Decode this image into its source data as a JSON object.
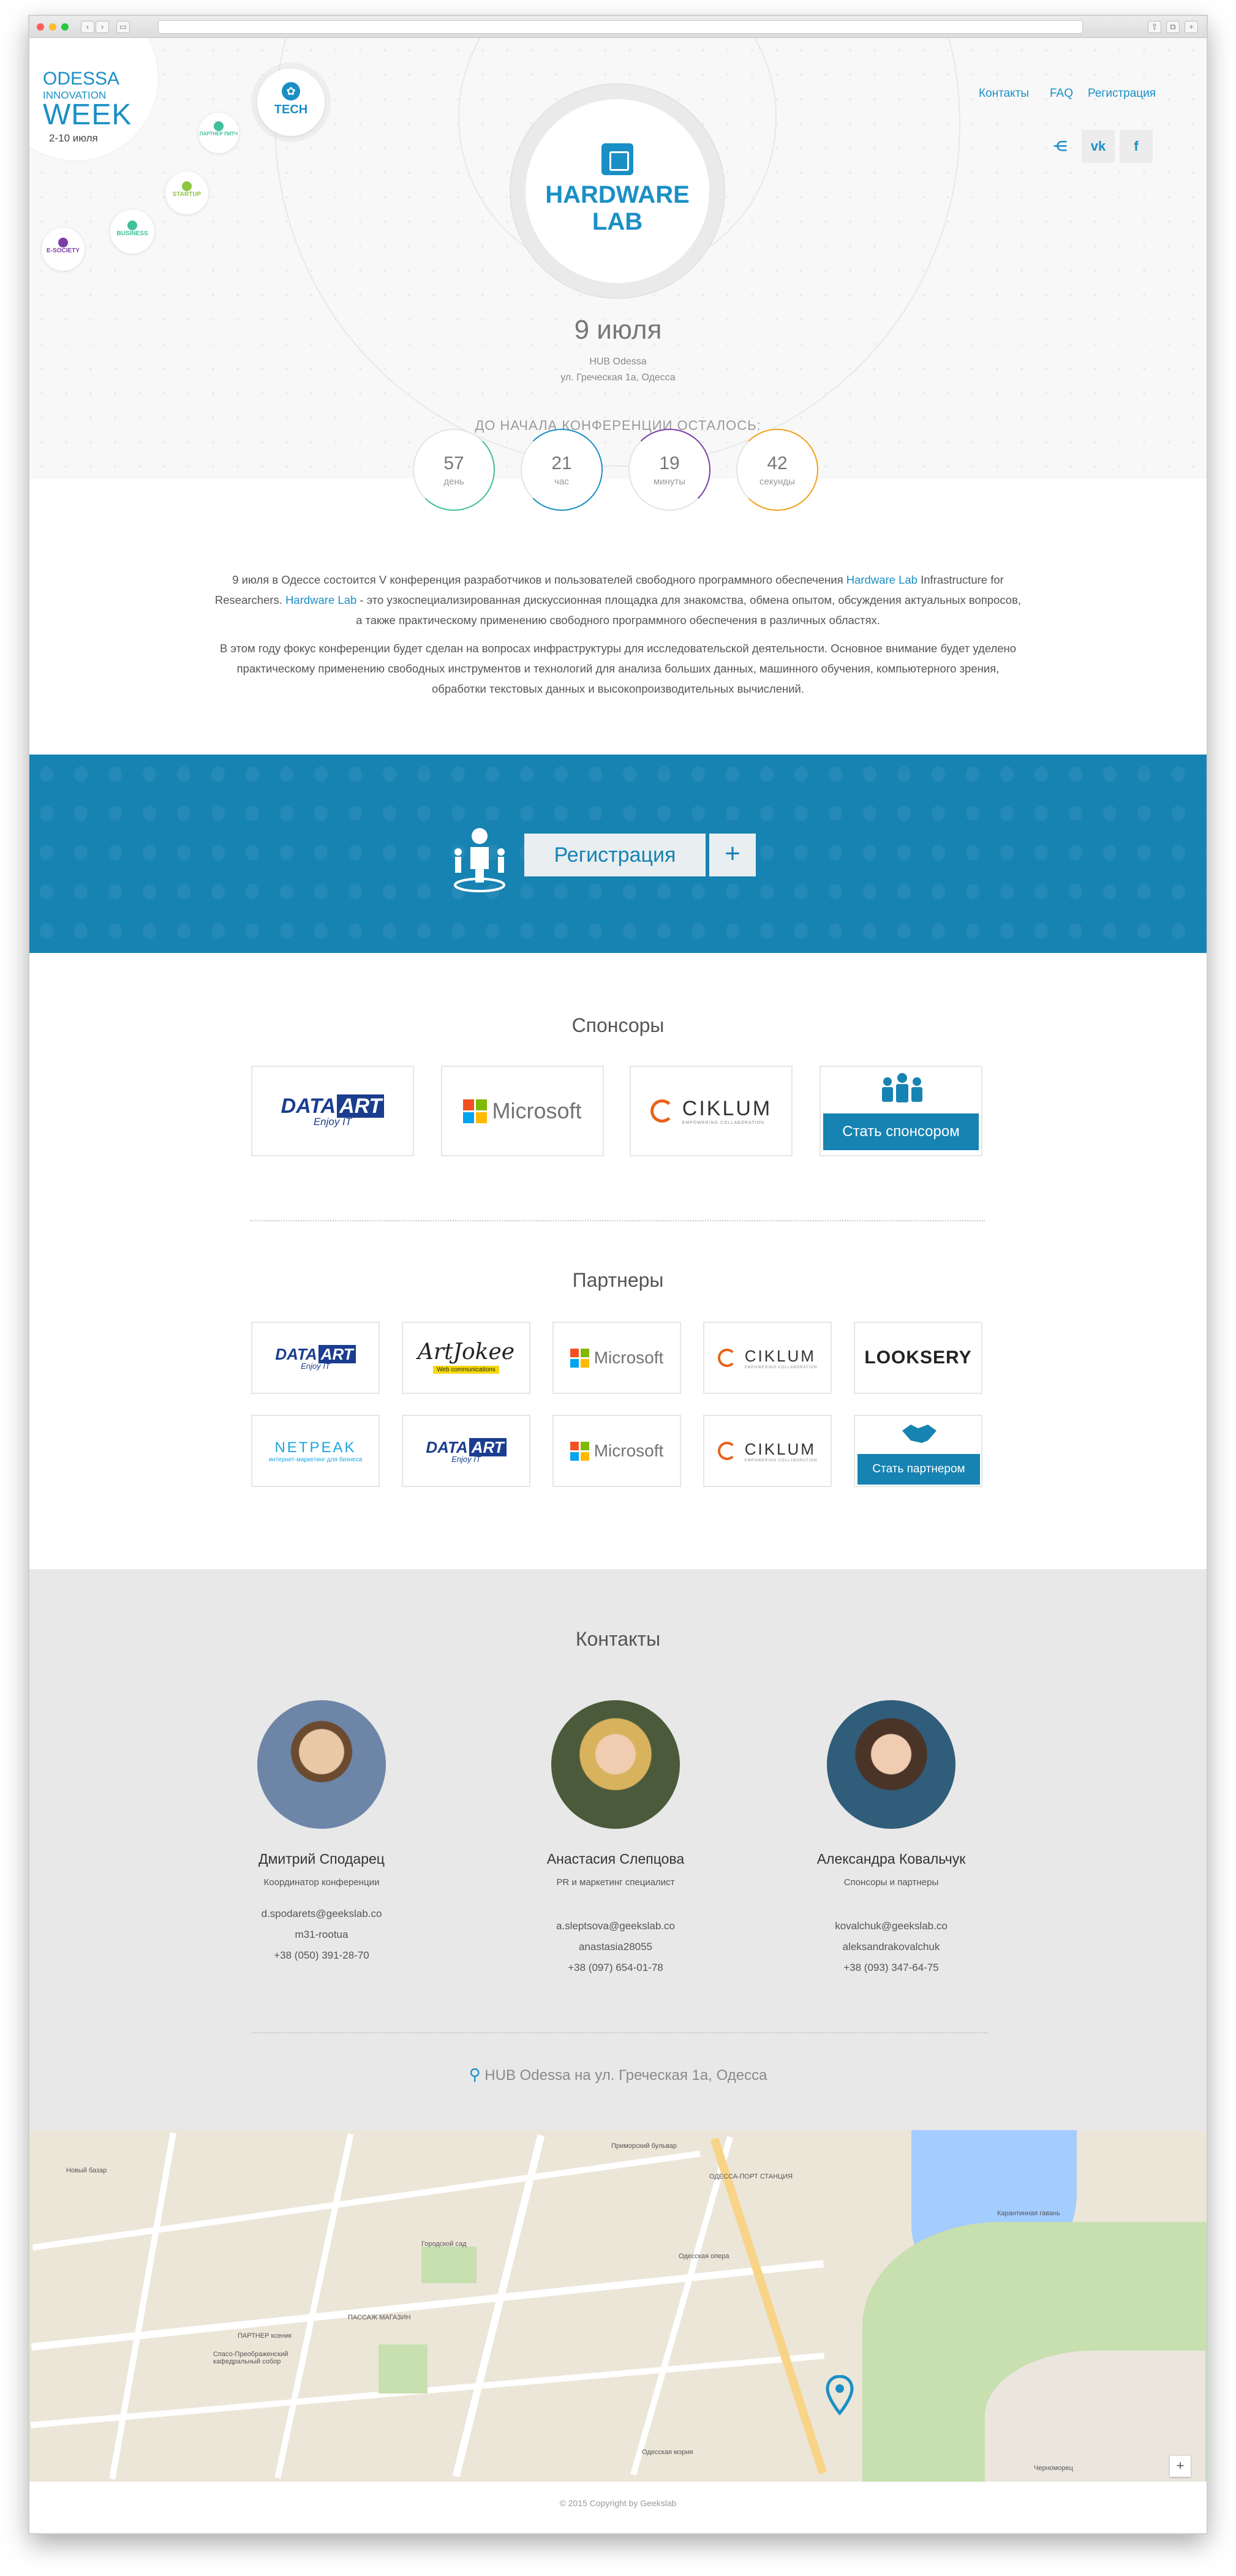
{
  "branding": {
    "city": "ODESSA",
    "innovation": "INNOVATION",
    "week": "WEEK",
    "dates": "2-10 июля"
  },
  "tracks": [
    {
      "label": "TECH"
    },
    {
      "label": "ПАРТНЕР ПИТЧ"
    },
    {
      "label": "STARTUP"
    },
    {
      "label": "BUSINESS"
    },
    {
      "label": "E-SOCIETY"
    }
  ],
  "nav": {
    "contacts": "Контакты",
    "faq": "FAQ",
    "register": "Регистрация"
  },
  "social": {
    "share_icon": "share-icon",
    "vk": "vk",
    "fb": "f"
  },
  "event": {
    "title_line1": "HARDWARE",
    "title_line2": "LAB",
    "date": "9 июля",
    "venue": "HUB Odessa",
    "address": "ул. Греческая 1а, Одесса"
  },
  "countdown": {
    "label": "ДО НАЧАЛА КОНФЕРЕНЦИИ ОСТАЛОСЬ:",
    "items": [
      {
        "value": "57",
        "unit": "день",
        "color": "#3fbf9a"
      },
      {
        "value": "21",
        "unit": "час",
        "color": "#1a8fc6"
      },
      {
        "value": "19",
        "unit": "минуты",
        "color": "#7b3fa8"
      },
      {
        "value": "42",
        "unit": "секунды",
        "color": "#f0a21a"
      }
    ]
  },
  "intro": {
    "p1_a": "9 июля в Одессе состоится V конференция разработчиков и пользователей свободного программного обеспечения ",
    "p1_link1": "Hardware Lab",
    "p1_b": " Infrastructure for Researchers. ",
    "p1_link2": "Hardware Lab",
    "p1_c": " - это узкоспециализированная  дискуссионная площадка для знакомства, обмена опытом, обсуждения актуальных вопросов, а также практическому применению свободного программного обеспечения в различных областях.",
    "p2": "В этом году фокус конференции будет сделан на вопросах инфраструктуры для исследовательской деятельности. Основное внимание будет уделено практическому применению свободных инструментов и технологий для анализа больших данных, машинного обучения, компьютерного зрения, обработки текстовых данных и высокопроизводительных вычислений."
  },
  "registration": {
    "button": "Регистрация",
    "plus": "+"
  },
  "sponsors": {
    "title": "Спонсоры",
    "become": "Стать спонсором"
  },
  "partners": {
    "title": "Партнеры",
    "become": "Стать партнером",
    "artjokee": "ArtJokee",
    "artjokee_sub": "Web communications",
    "looksery": "LOOKSERY",
    "netpeak": "NETPEAK",
    "netpeak_sub": "интернет-маркетинг для бизнеса"
  },
  "logos": {
    "dataart": "DATA",
    "dataart_box": "ART",
    "dataart_sub": "Enjoy IT",
    "microsoft": "Microsoft",
    "ciklum": "CIKLUM",
    "ciklum_sub": "EMPOWERING COLLABORATION"
  },
  "contacts": {
    "title": "Контакты",
    "people": [
      {
        "name": "Дмитрий Сподарец",
        "role": "Координатор конференции",
        "email": "d.spodarets@geekslab.co",
        "skype": "m31-rootua",
        "phone": "+38 (050) 391-28-70"
      },
      {
        "name": "Анастасия Слепцова",
        "role": "PR и маркетинг специалист",
        "email": "a.sleptsova@geekslab.co",
        "skype": "anastasia28055",
        "phone": "+38 (097) 654-01-78"
      },
      {
        "name": "Александра Ковальчук",
        "role": "Спонсоры и партнеры",
        "email": "kovalchuk@geekslab.co",
        "skype": "aleksandrakovalchuk",
        "phone": "+38 (093) 347-64-75"
      }
    ],
    "address_prefix": "HUB Odessa на  ",
    "address": "ул. Греческая 1а, Одесса"
  },
  "map": {
    "labels": [
      "Приморский бульвар",
      "ОДЕССА-ПОРТ СТАНЦИЯ",
      "Городской сад",
      "ПАССАЖ МАГАЗИН",
      "ПАРТНЕР ксеник",
      "Одесская опера",
      "Карантинная гавань",
      "Черноморец",
      "Новый базар",
      "Спасо-Преображенский кафедральный собор",
      "Одесская мэрия"
    ],
    "zoom_in": "+"
  },
  "footer": {
    "copyright": "© 2015 Copyright by Geekslab"
  }
}
